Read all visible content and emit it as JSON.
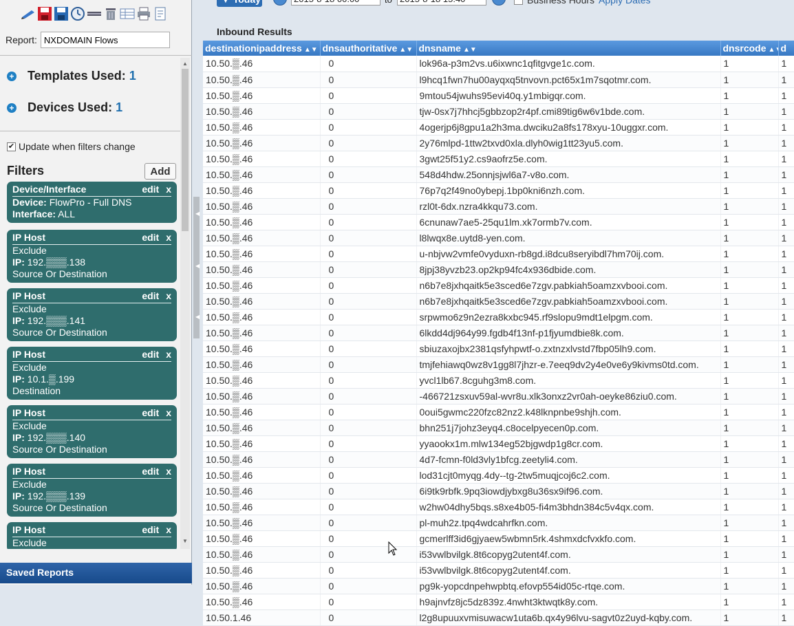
{
  "report": {
    "label": "Report:",
    "name": "NXDOMAIN Flows"
  },
  "sections": {
    "templates_label": "Templates Used:",
    "templates_count": "1",
    "devices_label": "Devices Used:",
    "devices_count": "1"
  },
  "update_filters_label": "Update when filters change",
  "filters": {
    "title": "Filters",
    "add_label": "Add",
    "edit_label": "edit",
    "remove_label": "x",
    "items": [
      {
        "type": "Device/Interface",
        "lines": [
          [
            "Device:",
            "FlowPro - Full DNS"
          ],
          [
            "Interface:",
            "ALL"
          ]
        ]
      },
      {
        "type": "IP Host",
        "lines": [
          [
            "",
            "Exclude"
          ],
          [
            "IP:",
            "192.▒▒▒.138"
          ],
          [
            "",
            "Source Or Destination"
          ]
        ]
      },
      {
        "type": "IP Host",
        "lines": [
          [
            "",
            "Exclude"
          ],
          [
            "IP:",
            "192.▒▒▒.141"
          ],
          [
            "",
            "Source Or Destination"
          ]
        ]
      },
      {
        "type": "IP Host",
        "lines": [
          [
            "",
            "Exclude"
          ],
          [
            "IP:",
            "10.1.▒.199"
          ],
          [
            "",
            "Destination"
          ]
        ]
      },
      {
        "type": "IP Host",
        "lines": [
          [
            "",
            "Exclude"
          ],
          [
            "IP:",
            "192.▒▒▒.140"
          ],
          [
            "",
            "Source Or Destination"
          ]
        ]
      },
      {
        "type": "IP Host",
        "lines": [
          [
            "",
            "Exclude"
          ],
          [
            "IP:",
            "192.▒▒▒.139"
          ],
          [
            "",
            "Source Or Destination"
          ]
        ]
      },
      {
        "type": "IP Host",
        "lines": [
          [
            "",
            "Exclude"
          ]
        ]
      }
    ]
  },
  "saved_reports_label": "Saved Reports",
  "date_bar": {
    "today_label": "▼ Today",
    "start": "2015-8-18 00:00",
    "to_label": "to",
    "end": "2015-8-18 15:40",
    "business_hours_label": "Business Hours",
    "apply_label": "Apply Dates"
  },
  "results": {
    "title": "Inbound Results",
    "columns": [
      "destinationipaddress",
      "dnsauthoritative",
      "dnsname",
      "dnsrcode",
      "d"
    ],
    "rows": [
      [
        "10.50.▒.46",
        "0",
        "lok96a-p3m2vs.u6ixwnc1qfitgvge1c.com.",
        "1",
        "1"
      ],
      [
        "10.50.▒.46",
        "0",
        "l9hcq1fwn7hu00ayqxq5tnvovn.pct65x1m7sqotmr.com.",
        "1",
        "1"
      ],
      [
        "10.50.▒.46",
        "0",
        "9mtou54jwuhs95evi40q.y1mbigqr.com.",
        "1",
        "1"
      ],
      [
        "10.50.▒.46",
        "0",
        "tjw-0sx7j7hhcj5gbbzop2r4pf.cmi89tig6w6v1bde.com.",
        "1",
        "1"
      ],
      [
        "10.50.▒.46",
        "0",
        "4ogerjp6j8gpu1a2h3ma.dwciku2a8fs178xyu-10uggxr.com.",
        "1",
        "1"
      ],
      [
        "10.50.▒.46",
        "0",
        "2y76mlpd-1ttw2txvd0xla.dlyh0wig1tt23yu5.com.",
        "1",
        "1"
      ],
      [
        "10.50.▒.46",
        "0",
        "3gwt25f51y2.cs9aofrz5e.com.",
        "1",
        "1"
      ],
      [
        "10.50.▒.46",
        "0",
        "548d4hdw.25onnjsjwl6a7-v8o.com.",
        "1",
        "1"
      ],
      [
        "10.50.▒.46",
        "0",
        "76p7q2f49no0ybepj.1bp0kni6nzh.com.",
        "1",
        "1"
      ],
      [
        "10.50.▒.46",
        "0",
        "rzl0t-6dx.nzra4kkqu73.com.",
        "1",
        "1"
      ],
      [
        "10.50.▒.46",
        "0",
        "6cnunaw7ae5-25qu1lm.xk7ormb7v.com.",
        "1",
        "1"
      ],
      [
        "10.50.▒.46",
        "0",
        "l8lwqx8e.uytd8-yen.com.",
        "1",
        "1"
      ],
      [
        "10.50.▒.46",
        "0",
        "u-nbjvw2vmfe0vyduxn-rb8gd.i8dcu8seryibdl7hm70ij.com.",
        "1",
        "1"
      ],
      [
        "10.50.▒.46",
        "0",
        "8jpj38yvzb23.op2kp94fc4x936dbide.com.",
        "1",
        "1"
      ],
      [
        "10.50.▒.46",
        "0",
        "n6b7e8jxhqaitk5e3sced6e7zgv.pabkiah5oamzxvbooi.com.",
        "1",
        "1"
      ],
      [
        "10.50.▒.46",
        "0",
        "n6b7e8jxhqaitk5e3sced6e7zgv.pabkiah5oamzxvbooi.com.",
        "1",
        "1"
      ],
      [
        "10.50.▒.46",
        "0",
        "srpwmo6z9n2ezra8kxbc945.rf9slopu9mdt1elpgm.com.",
        "1",
        "1"
      ],
      [
        "10.50.▒.46",
        "0",
        "6lkdd4dj964y99.fgdb4f13nf-p1fjyumdbie8k.com.",
        "1",
        "1"
      ],
      [
        "10.50.▒.46",
        "0",
        "sbiuzaxojbx2381qsfyhpwtf-o.zxtnzxlvstd7fbp05lh9.com.",
        "1",
        "1"
      ],
      [
        "10.50.▒.46",
        "0",
        "tmjfehiawq0wz8v1gg8l7jhzr-e.7eeq9dv2y4e0ve6y9kivms0td.com.",
        "1",
        "1"
      ],
      [
        "10.50.▒.46",
        "0",
        "yvcl1lb67.8cguhg3m8.com.",
        "1",
        "1"
      ],
      [
        "10.50.▒.46",
        "0",
        "-466721zsxuv59al-wvr8u.xlk3onxz2vr0ah-oeyke86ziu0.com.",
        "1",
        "1"
      ],
      [
        "10.50.▒.46",
        "0",
        "0oui5gwmc220fzc82nz2.k48lknpnbe9shjh.com.",
        "1",
        "1"
      ],
      [
        "10.50.▒.46",
        "0",
        "bhn251j7johz3eyq4.c8ocelpyecen0p.com.",
        "1",
        "1"
      ],
      [
        "10.50.▒.46",
        "0",
        "yyaookx1m.mlw134eg52bjgwdp1g8cr.com.",
        "1",
        "1"
      ],
      [
        "10.50.▒.46",
        "0",
        "4d7-fcmn-f0ld3vly1bfcg.zeetyli4.com.",
        "1",
        "1"
      ],
      [
        "10.50.▒.46",
        "0",
        "lod31cjt0myqg.4dy--tg-2tw5muqjcoj6c2.com.",
        "1",
        "1"
      ],
      [
        "10.50.▒.46",
        "0",
        "6i9tk9rbfk.9pq3iowdjybxg8u36sx9if96.com.",
        "1",
        "1"
      ],
      [
        "10.50.▒.46",
        "0",
        "w2hw04dhy5bqs.s8xe4b05-fi4m3bhdn384c5v4qx.com.",
        "1",
        "1"
      ],
      [
        "10.50.▒.46",
        "0",
        "pl-muh2z.tpq4wdcahrfkn.com.",
        "1",
        "1"
      ],
      [
        "10.50.▒.46",
        "0",
        "gcmerlff3id6gjyaew5wbmn5rk.4shmxdcfvxkfo.com.",
        "1",
        "1"
      ],
      [
        "10.50.▒.46",
        "0",
        "i53vwlbvilgk.8t6copyg2utent4f.com.",
        "1",
        "1"
      ],
      [
        "10.50.▒.46",
        "0",
        "i53vwlbvilgk.8t6copyg2utent4f.com.",
        "1",
        "1"
      ],
      [
        "10.50.▒.46",
        "0",
        "pg9k-yopcdnpehwpbtq.efovp554id05c-rtqe.com.",
        "1",
        "1"
      ],
      [
        "10.50.▒.46",
        "0",
        "h9ajnvfz8jc5dz839z.4nwht3ktwqtk8y.com.",
        "1",
        "1"
      ],
      [
        "10.50.1.46",
        "0",
        "l2g8upuuxvmisuwacw1uta6b.qx4y96lvu-sagvt0z2uyd-kqby.com.",
        "1",
        "1"
      ]
    ]
  },
  "toolbar_icons": [
    "pencil-icon",
    "save-icon",
    "save-as-icon",
    "clock-icon",
    "ruler-icon",
    "trash-icon",
    "table-icon",
    "print-icon",
    "export-icon"
  ],
  "colors": {
    "filter_card": "#2f6d6d",
    "header_blue": "#3778c3",
    "accent": "#1f80c4"
  }
}
